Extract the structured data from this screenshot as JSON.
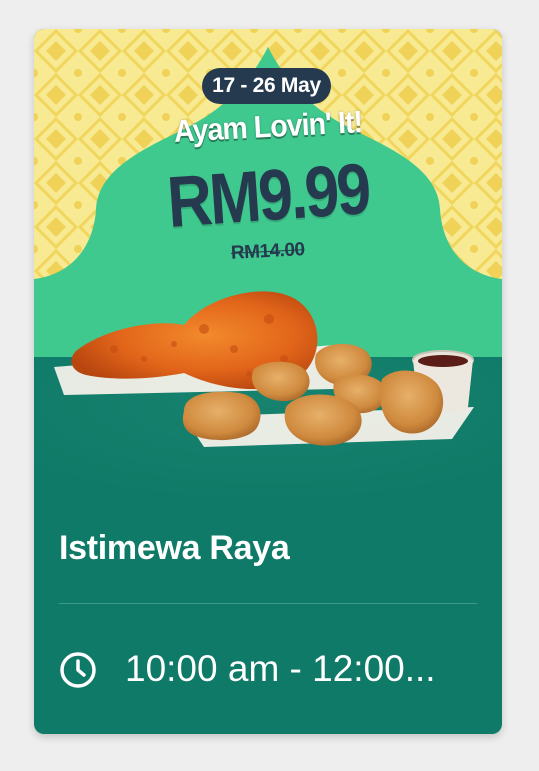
{
  "promo": {
    "date_range": "17 - 26 May",
    "tagline": "Ayam Lovin' It!",
    "price": "RM9.99",
    "old_price": "RM14.00",
    "title": "Istimewa Raya",
    "hours": "10:00 am - 12:00..."
  },
  "icons": {
    "time": "clock-icon"
  },
  "colors": {
    "card_background": "#0f7a67",
    "banner_pattern_yellow": "#f4e58a",
    "banner_arch_green": "#3fc98f",
    "price_navy": "#263a4f",
    "text_white": "#ffffff"
  }
}
